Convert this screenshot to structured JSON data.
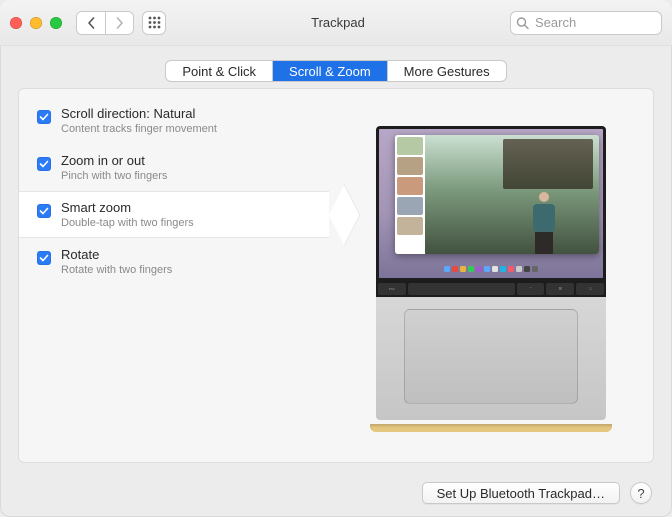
{
  "window": {
    "title": "Trackpad",
    "search_placeholder": "Search"
  },
  "tabs": [
    {
      "label": "Point & Click",
      "active": false
    },
    {
      "label": "Scroll & Zoom",
      "active": true
    },
    {
      "label": "More Gestures",
      "active": false
    }
  ],
  "options": [
    {
      "title": "Scroll direction: Natural",
      "sub": "Content tracks finger movement",
      "checked": true,
      "selected": false
    },
    {
      "title": "Zoom in or out",
      "sub": "Pinch with two fingers",
      "checked": true,
      "selected": false
    },
    {
      "title": "Smart zoom",
      "sub": "Double-tap with two fingers",
      "checked": true,
      "selected": true
    },
    {
      "title": "Rotate",
      "sub": "Rotate with two fingers",
      "checked": true,
      "selected": false
    }
  ],
  "touchbar_keys": [
    "esc",
    "⌃",
    "⌘",
    "⌥"
  ],
  "footer": {
    "setup_bt": "Set Up Bluetooth Trackpad…",
    "help": "?"
  },
  "colors": {
    "accent": "#1f71e8",
    "checkbox": "#2b7bf6"
  }
}
